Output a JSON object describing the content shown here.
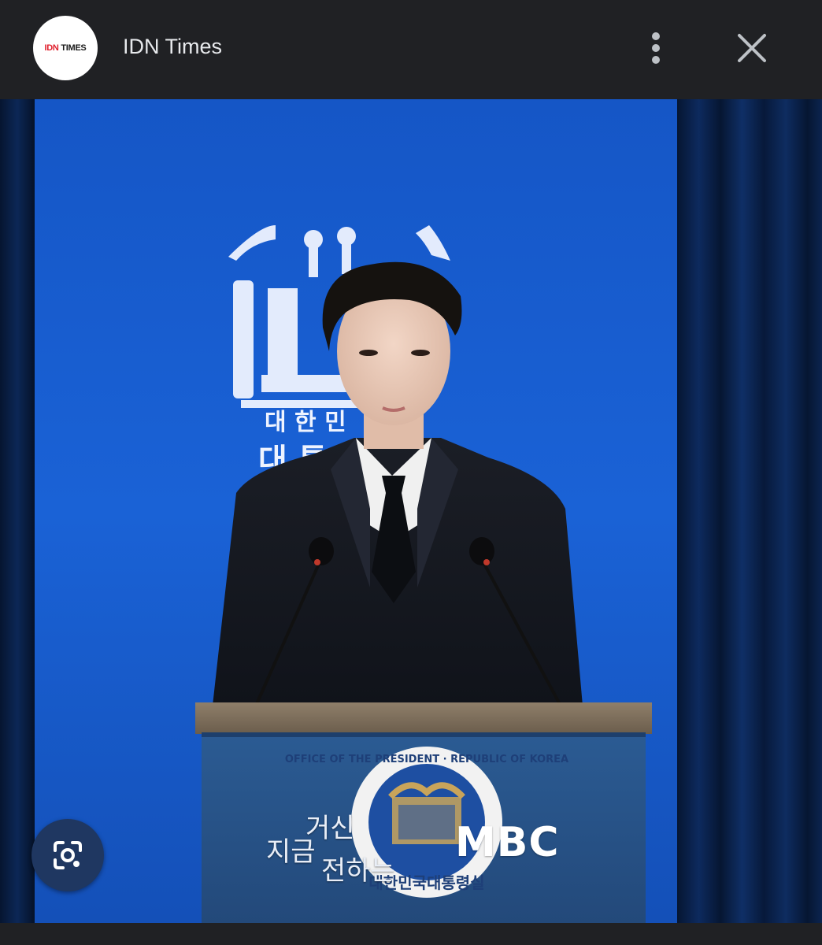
{
  "header": {
    "source_name": "IDN Times",
    "logo": {
      "text_red": "IDN",
      "text_dark": "TIMES",
      "red_color": "#e01e2b"
    },
    "more_icon": "more-vert-icon",
    "close_icon": "close-icon"
  },
  "image": {
    "overlay_line_1": "거신",
    "overlay_line_2": "지금",
    "overlay_line_3": "전하는",
    "broadcaster_logo": "MBC",
    "seal_ring_text": "OFFICE OF THE PRESIDENT · REPUBLIC OF KOREA",
    "seal_bottom_text": "대한민국대통령실",
    "backdrop_text_1": "대 한 민",
    "backdrop_text_2": "대 통"
  },
  "actions": {
    "visual_search_icon": "lens-camera-icon"
  },
  "colors": {
    "chrome_bg": "#202124",
    "chrome_text": "#e8eaed",
    "backdrop_blue": "#1a5fd0",
    "curtain_navy": "#0a1f46",
    "lens_button": "#1f3761"
  }
}
